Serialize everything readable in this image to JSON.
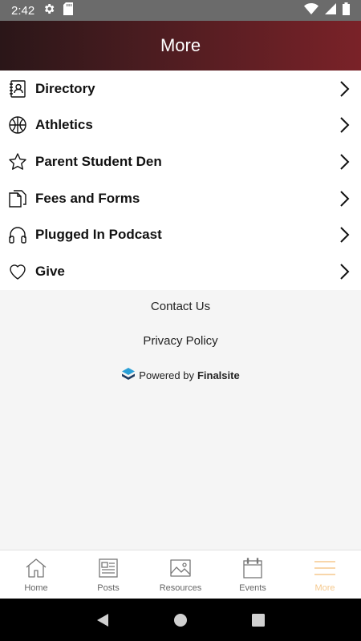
{
  "status_bar": {
    "time": "2:42"
  },
  "header": {
    "title": "More"
  },
  "menu": {
    "items": [
      {
        "label": "Directory",
        "icon": "contact-book-icon"
      },
      {
        "label": "Athletics",
        "icon": "basketball-icon"
      },
      {
        "label": "Parent Student Den",
        "icon": "star-icon"
      },
      {
        "label": "Fees and Forms",
        "icon": "documents-icon"
      },
      {
        "label": "Plugged In Podcast",
        "icon": "headphones-icon"
      },
      {
        "label": "Give",
        "icon": "heart-icon"
      }
    ]
  },
  "footer": {
    "contact": "Contact Us",
    "privacy": "Privacy Policy",
    "powered_prefix": "Powered by",
    "powered_brand": "Finalsite"
  },
  "tabs": [
    {
      "label": "Home",
      "icon": "home-icon"
    },
    {
      "label": "Posts",
      "icon": "newspaper-icon"
    },
    {
      "label": "Resources",
      "icon": "image-icon"
    },
    {
      "label": "Events",
      "icon": "calendar-icon"
    },
    {
      "label": "More",
      "icon": "menu-icon",
      "active": true
    }
  ],
  "colors": {
    "header_start": "#2a1618",
    "header_end": "#7a2228",
    "active_tab": "#f5c98e"
  }
}
